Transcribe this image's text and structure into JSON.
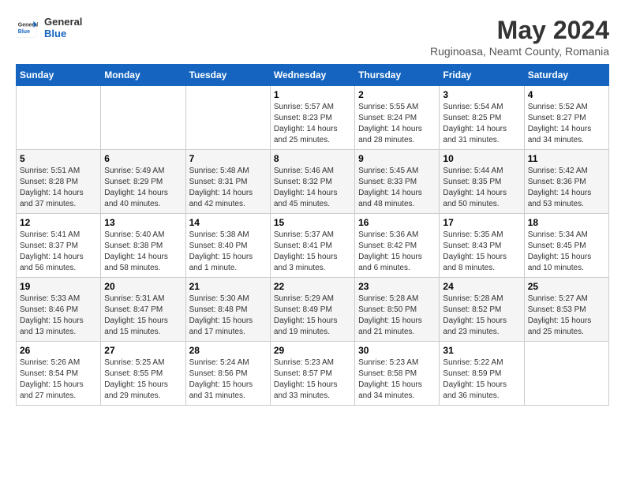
{
  "header": {
    "logo_general": "General",
    "logo_blue": "Blue",
    "month_year": "May 2024",
    "location": "Ruginoasa, Neamt County, Romania"
  },
  "days_of_week": [
    "Sunday",
    "Monday",
    "Tuesday",
    "Wednesday",
    "Thursday",
    "Friday",
    "Saturday"
  ],
  "weeks": [
    [
      {
        "day": "",
        "info": ""
      },
      {
        "day": "",
        "info": ""
      },
      {
        "day": "",
        "info": ""
      },
      {
        "day": "1",
        "sunrise": "5:57 AM",
        "sunset": "8:23 PM",
        "daylight": "14 hours and 25 minutes."
      },
      {
        "day": "2",
        "sunrise": "5:55 AM",
        "sunset": "8:24 PM",
        "daylight": "14 hours and 28 minutes."
      },
      {
        "day": "3",
        "sunrise": "5:54 AM",
        "sunset": "8:25 PM",
        "daylight": "14 hours and 31 minutes."
      },
      {
        "day": "4",
        "sunrise": "5:52 AM",
        "sunset": "8:27 PM",
        "daylight": "14 hours and 34 minutes."
      }
    ],
    [
      {
        "day": "5",
        "sunrise": "5:51 AM",
        "sunset": "8:28 PM",
        "daylight": "14 hours and 37 minutes."
      },
      {
        "day": "6",
        "sunrise": "5:49 AM",
        "sunset": "8:29 PM",
        "daylight": "14 hours and 40 minutes."
      },
      {
        "day": "7",
        "sunrise": "5:48 AM",
        "sunset": "8:31 PM",
        "daylight": "14 hours and 42 minutes."
      },
      {
        "day": "8",
        "sunrise": "5:46 AM",
        "sunset": "8:32 PM",
        "daylight": "14 hours and 45 minutes."
      },
      {
        "day": "9",
        "sunrise": "5:45 AM",
        "sunset": "8:33 PM",
        "daylight": "14 hours and 48 minutes."
      },
      {
        "day": "10",
        "sunrise": "5:44 AM",
        "sunset": "8:35 PM",
        "daylight": "14 hours and 50 minutes."
      },
      {
        "day": "11",
        "sunrise": "5:42 AM",
        "sunset": "8:36 PM",
        "daylight": "14 hours and 53 minutes."
      }
    ],
    [
      {
        "day": "12",
        "sunrise": "5:41 AM",
        "sunset": "8:37 PM",
        "daylight": "14 hours and 56 minutes."
      },
      {
        "day": "13",
        "sunrise": "5:40 AM",
        "sunset": "8:38 PM",
        "daylight": "14 hours and 58 minutes."
      },
      {
        "day": "14",
        "sunrise": "5:38 AM",
        "sunset": "8:40 PM",
        "daylight": "15 hours and 1 minute."
      },
      {
        "day": "15",
        "sunrise": "5:37 AM",
        "sunset": "8:41 PM",
        "daylight": "15 hours and 3 minutes."
      },
      {
        "day": "16",
        "sunrise": "5:36 AM",
        "sunset": "8:42 PM",
        "daylight": "15 hours and 6 minutes."
      },
      {
        "day": "17",
        "sunrise": "5:35 AM",
        "sunset": "8:43 PM",
        "daylight": "15 hours and 8 minutes."
      },
      {
        "day": "18",
        "sunrise": "5:34 AM",
        "sunset": "8:45 PM",
        "daylight": "15 hours and 10 minutes."
      }
    ],
    [
      {
        "day": "19",
        "sunrise": "5:33 AM",
        "sunset": "8:46 PM",
        "daylight": "15 hours and 13 minutes."
      },
      {
        "day": "20",
        "sunrise": "5:31 AM",
        "sunset": "8:47 PM",
        "daylight": "15 hours and 15 minutes."
      },
      {
        "day": "21",
        "sunrise": "5:30 AM",
        "sunset": "8:48 PM",
        "daylight": "15 hours and 17 minutes."
      },
      {
        "day": "22",
        "sunrise": "5:29 AM",
        "sunset": "8:49 PM",
        "daylight": "15 hours and 19 minutes."
      },
      {
        "day": "23",
        "sunrise": "5:28 AM",
        "sunset": "8:50 PM",
        "daylight": "15 hours and 21 minutes."
      },
      {
        "day": "24",
        "sunrise": "5:28 AM",
        "sunset": "8:52 PM",
        "daylight": "15 hours and 23 minutes."
      },
      {
        "day": "25",
        "sunrise": "5:27 AM",
        "sunset": "8:53 PM",
        "daylight": "15 hours and 25 minutes."
      }
    ],
    [
      {
        "day": "26",
        "sunrise": "5:26 AM",
        "sunset": "8:54 PM",
        "daylight": "15 hours and 27 minutes."
      },
      {
        "day": "27",
        "sunrise": "5:25 AM",
        "sunset": "8:55 PM",
        "daylight": "15 hours and 29 minutes."
      },
      {
        "day": "28",
        "sunrise": "5:24 AM",
        "sunset": "8:56 PM",
        "daylight": "15 hours and 31 minutes."
      },
      {
        "day": "29",
        "sunrise": "5:23 AM",
        "sunset": "8:57 PM",
        "daylight": "15 hours and 33 minutes."
      },
      {
        "day": "30",
        "sunrise": "5:23 AM",
        "sunset": "8:58 PM",
        "daylight": "15 hours and 34 minutes."
      },
      {
        "day": "31",
        "sunrise": "5:22 AM",
        "sunset": "8:59 PM",
        "daylight": "15 hours and 36 minutes."
      },
      {
        "day": "",
        "info": ""
      }
    ]
  ],
  "labels": {
    "sunrise": "Sunrise:",
    "sunset": "Sunset:",
    "daylight": "Daylight:"
  }
}
